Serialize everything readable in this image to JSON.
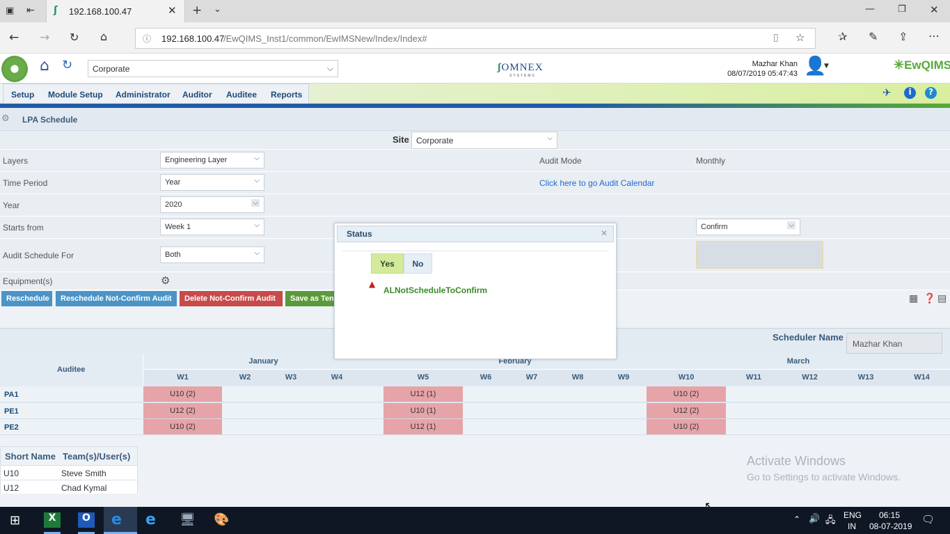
{
  "browser": {
    "tab_title": "192.168.100.47",
    "url_host": "192.168.100.47",
    "url_path": "/EwQIMS_Inst1/common/EwIMSNew/Index/Index#"
  },
  "header": {
    "site_select": "Corporate",
    "brand": "OMNEX",
    "brand_sub": "SYSTEMS",
    "user_name": "Mazhar Khan",
    "datetime": "08/07/2019 05:47:43",
    "product": "EwQIMS"
  },
  "menu": {
    "items": [
      "Setup",
      "Module Setup",
      "Administrator",
      "Auditor",
      "Auditee",
      "Reports"
    ]
  },
  "page": {
    "title": "LPA Schedule"
  },
  "form": {
    "site_label": "Site",
    "site_value": "Corporate",
    "layers_label": "Layers",
    "layers_value": "Engineering Layer",
    "audit_mode_label": "Audit Mode",
    "audit_mode_value": "Monthly",
    "time_period_label": "Time Period",
    "time_period_value": "Year",
    "calendar_link": "Click here to go Audit Calendar",
    "year_label": "Year",
    "year_value": "2020",
    "starts_from_label": "Starts from",
    "starts_from_value": "Week 1",
    "confirm_value": "Confirm",
    "schedule_for_label": "Audit Schedule For",
    "schedule_for_value": "Both",
    "equipment_label": "Equipment(s)"
  },
  "buttons": {
    "reschedule": "Reschedule",
    "reschedule_nc": "Reschedule Not-Confirm Audit",
    "delete_nc": "Delete Not-Confirm Audit",
    "save_template": "Save as Ten"
  },
  "scheduler": {
    "label": "Scheduler Name",
    "value": "Mazhar Khan"
  },
  "grid": {
    "auditee_header": "Auditee",
    "months": [
      "January",
      "February",
      "March"
    ],
    "weeks": [
      "W1",
      "W2",
      "W3",
      "W4",
      "W5",
      "W6",
      "W7",
      "W8",
      "W9",
      "W10",
      "W11",
      "W12",
      "W13",
      "W14"
    ],
    "rows": [
      {
        "name": "PA1",
        "cells": {
          "W1": "U10 (2)",
          "W5": "U12 (1)",
          "W10": "U10 (2)"
        }
      },
      {
        "name": "PE1",
        "cells": {
          "W1": "U12 (2)",
          "W5": "U10 (1)",
          "W10": "U12 (2)"
        }
      },
      {
        "name": "PE2",
        "cells": {
          "W1": "U10 (2)",
          "W5": "U12 (1)",
          "W10": "U10 (2)"
        }
      }
    ]
  },
  "legend": {
    "headers": [
      "Short Name",
      "Team(s)/User(s)"
    ],
    "rows": [
      [
        "U10",
        "Steve Smith"
      ],
      [
        "U12",
        "Chad Kymal"
      ]
    ]
  },
  "dialog": {
    "title": "Status",
    "yes": "Yes",
    "no": "No",
    "message": "ALNotScheduleToConfirm"
  },
  "watermark": {
    "line1": "Activate Windows",
    "line2": "Go to Settings to activate Windows."
  },
  "taskbar": {
    "lang": "ENG",
    "region": "IN",
    "time": "06:15",
    "date": "08-07-2019"
  }
}
